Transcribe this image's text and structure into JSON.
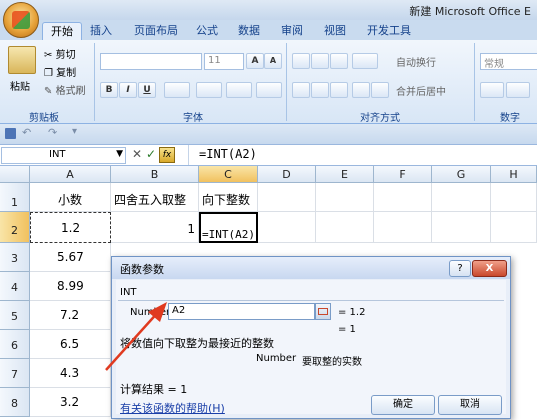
{
  "window": {
    "title": "新建 Microsoft Office E"
  },
  "ribbon_tabs": [
    "开始",
    "插入",
    "页面布局",
    "公式",
    "数据",
    "审阅",
    "视图",
    "开发工具"
  ],
  "clipboard": {
    "paste": "粘贴",
    "cut": "剪切",
    "copy": "复制",
    "format_painter": "格式刷",
    "label": "剪贴板"
  },
  "font": {
    "size": "11",
    "bold": "B",
    "italic": "I",
    "underline": "U",
    "label": "字体",
    "grow": "A",
    "shrink": "A"
  },
  "alignment": {
    "wrap": "自动换行",
    "merge": "合并后居中",
    "label": "对齐方式"
  },
  "number": {
    "format": "常规",
    "label": "数字"
  },
  "formula_bar": {
    "name_box": "INT",
    "fx": "fx",
    "formula": "=INT(A2)"
  },
  "columns": [
    "A",
    "B",
    "C",
    "D",
    "E",
    "F",
    "G",
    "H"
  ],
  "rows": [
    "1",
    "2",
    "3",
    "4",
    "5",
    "6",
    "7",
    "8"
  ],
  "cells": {
    "A1": "小数",
    "B1": "四舍五入取整",
    "C1": "向下整数",
    "A2": "1.2",
    "B2": "1",
    "C2": "=INT(A2)",
    "A3": "5.67",
    "A4": "8.99",
    "A5": "7.2",
    "A6": "6.5",
    "A7": "4.3",
    "A8": "3.2"
  },
  "dialog": {
    "title": "函数参数",
    "function_name": "INT",
    "arg_label": "Number",
    "arg_value": "A2",
    "arg_result": "= 1.2",
    "result_preview": "= 1",
    "description": "将数值向下取整为最接近的整数",
    "arg_description_name": "Number",
    "arg_description": "要取整的实数",
    "calc_result": "计算结果 = 1",
    "help_link": "有关该函数的帮助(H)",
    "ok": "确定",
    "cancel": "取消",
    "help_btn": "?",
    "close_btn": "X"
  },
  "colors": {
    "accent": "#15428b",
    "arrow": "#e03a20"
  }
}
